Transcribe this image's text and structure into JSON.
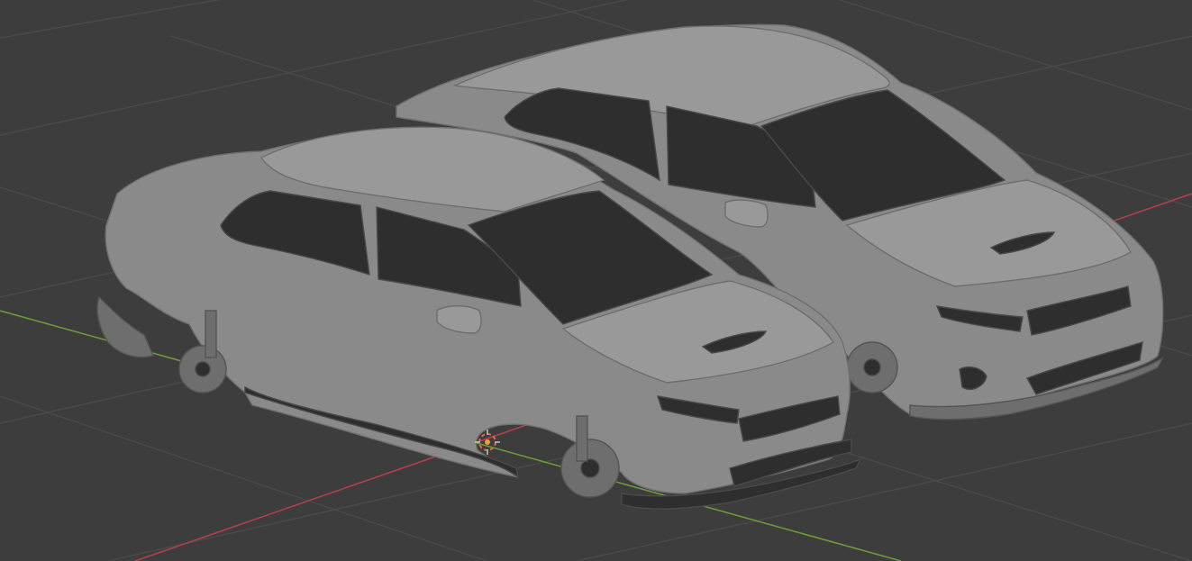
{
  "viewport": {
    "background_color": "#3d3d3d",
    "grid_color": "#4b4b4b",
    "axis_x_color": "#b0404a",
    "axis_y_color": "#6a9a3a",
    "mesh_color": "#8a8a8a",
    "mesh_shadow_color": "#6e6e6e",
    "mesh_dark_color": "#2e2e2e",
    "cursor_color": "#e06a4a"
  },
  "scene": {
    "objects": [
      {
        "kind": "car-body",
        "state": "disassembled",
        "icon": "car-mesh"
      },
      {
        "kind": "car-body",
        "state": "assembled",
        "icon": "car-mesh"
      }
    ],
    "cursor": {
      "icon": "3d-cursor-icon"
    }
  }
}
